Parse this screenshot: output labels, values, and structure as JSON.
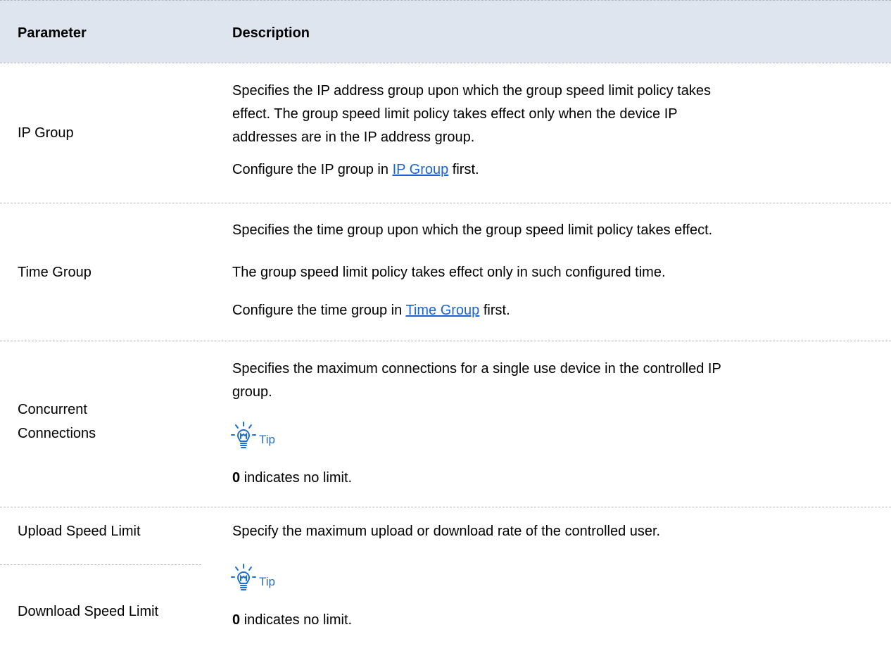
{
  "header": {
    "col_param": "Parameter",
    "col_desc": "Description"
  },
  "rows": [
    {
      "param": "IP Group",
      "desc_lines": [
        "Specifies the IP address group upon which the group speed limit policy takes",
        "effect. The group speed limit policy takes effect only when the device IP",
        "addresses are in the IP address group."
      ],
      "config_prefix": "Configure the IP group in ",
      "config_link": "IP Group",
      "config_suffix": " first."
    },
    {
      "param": "Time Group",
      "desc_line1": "Specifies the time group upon which the group speed limit policy takes effect.",
      "desc_line2": "The group speed limit policy takes effect only in such configured time.",
      "config_prefix": "Configure the time group in ",
      "config_link": "Time Group",
      "config_suffix": " first."
    },
    {
      "param_line1": "Concurrent",
      "param_line2": "Connections",
      "desc_lines": [
        "Specifies the maximum connections for a single use device in the controlled IP",
        "group."
      ],
      "tip_label": "Tip",
      "tip_bold": "0",
      "tip_rest": " indicates no limit."
    },
    {
      "param_upload": "Upload Speed Limit",
      "param_download": "Download Speed Limit",
      "desc": "Specify the maximum upload or download rate of the controlled user.",
      "tip_label": "Tip",
      "tip_bold": "0",
      "tip_rest": " indicates no limit."
    }
  ],
  "icons": {
    "tip": "lightbulb-icon"
  },
  "colors": {
    "header_bg": "#dfe5ef",
    "link": "#1a63d6",
    "tip": "#1f6fd1"
  }
}
